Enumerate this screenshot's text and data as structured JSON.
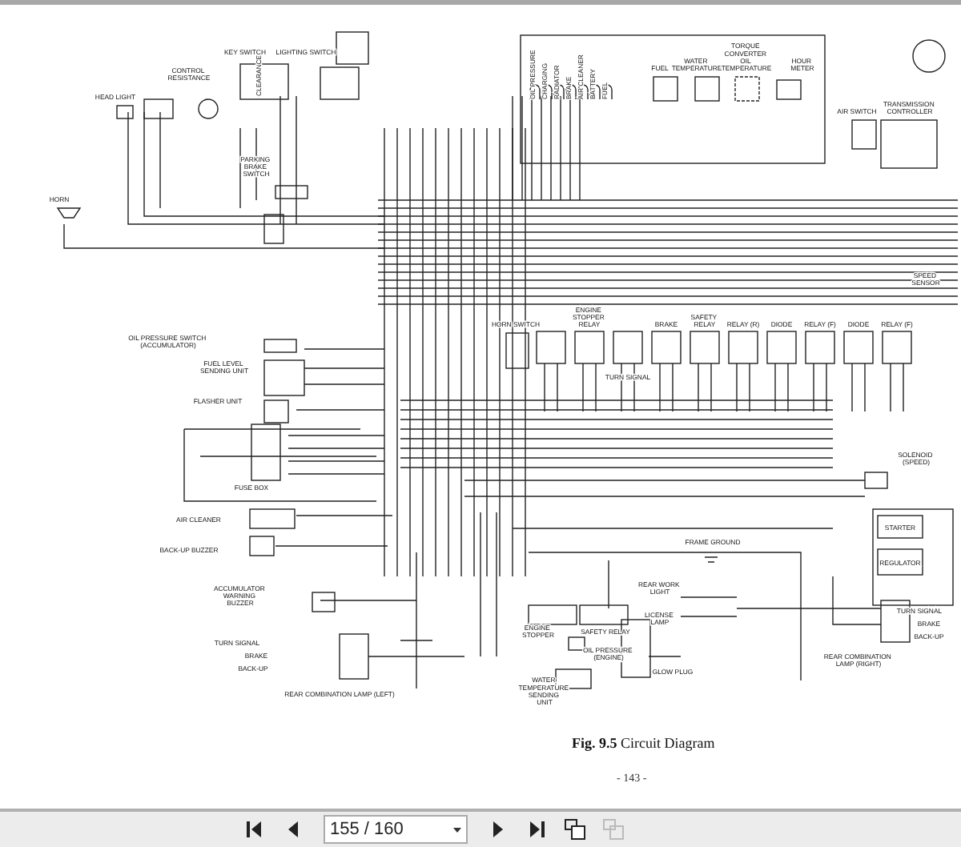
{
  "document": {
    "labels": [
      "HEAD LIGHT",
      "CLEARANCE",
      "CONTROL RESISTANCE",
      "KEY SWITCH",
      "LIGHTING SWITCH",
      "PARKING BRAKE SWITCH",
      "HORN",
      "OIL PRESSURE",
      "CHARGING",
      "RADIATOR",
      "BRAKE",
      "AIR CLEANER",
      "BATTERY",
      "FUEL",
      "FUEL",
      "WATER TEMPERATURE",
      "TORQUE CONVERTER OIL TEMPERATURE",
      "HOUR METER",
      "AIR SWITCH",
      "TRANSMISSION CONTROLLER",
      "SPEED SENSOR",
      "OIL PRESSURE SWITCH (ACCUMULATOR)",
      "FUEL LEVEL SENDING UNIT",
      "FLASHER UNIT",
      "FUSE BOX",
      "AIR CLEANER",
      "BACK-UP BUZZER",
      "HORN SWITCH",
      "ENGINE STOPPER RELAY",
      "TURN SIGNAL",
      "BRAKE",
      "SAFETY RELAY",
      "RELAY (R)",
      "DIODE",
      "RELAY (F)",
      "DIODE",
      "RELAY (F)",
      "SOLENOID (SPEED)",
      "STARTER",
      "REGULATOR",
      "FRAME GROUND",
      "ACCUMULATOR WARNING BUZZER",
      "TURN SIGNAL",
      "BRAKE",
      "BACK-UP",
      "REAR COMBINATION LAMP (LEFT)",
      "ENGINE STOPPER",
      "SAFETY RELAY",
      "REAR WORK LIGHT",
      "LICENSE LAMP",
      "OIL PRESSURE (ENGINE)",
      "GLOW PLUG",
      "WATER TEMPERATURE SENDING UNIT",
      "TURN SIGNAL",
      "BRAKE",
      "BACK-UP",
      "REAR COMBINATION LAMP (RIGHT)"
    ],
    "caption": "**Fig. 9.5** Circuit Diagram",
    "page_number": "- 143 -"
  },
  "toolbar": {
    "page_field": "155 / 160",
    "buttons": [
      {
        "kind": "first",
        "disabled": false
      },
      {
        "kind": "prev",
        "disabled": false
      },
      {
        "kind": "next",
        "disabled": false
      },
      {
        "kind": "last",
        "disabled": false
      },
      {
        "kind": "view",
        "disabled": false
      },
      {
        "kind": "view2",
        "disabled": true
      }
    ]
  }
}
